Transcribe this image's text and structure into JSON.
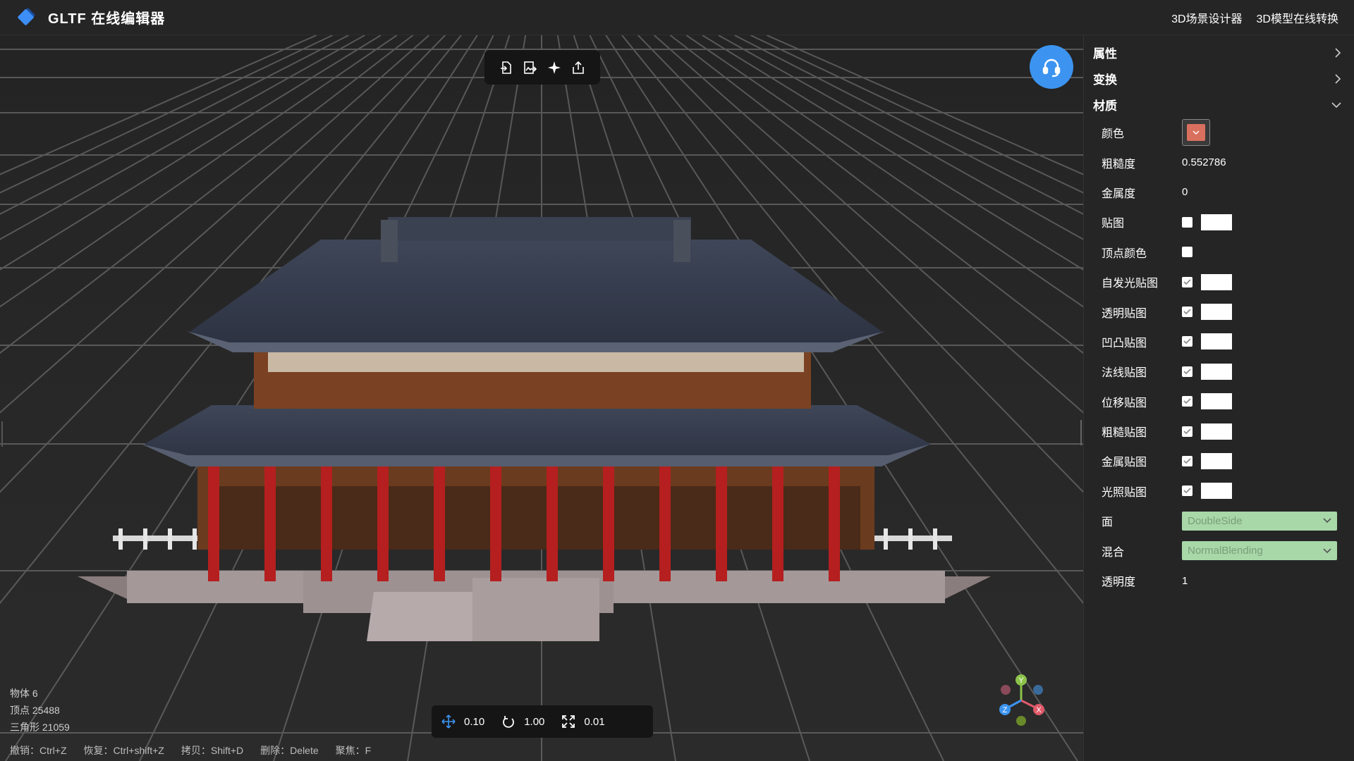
{
  "header": {
    "title": "GLTF 在线编辑器",
    "links": [
      "3D场景设计器",
      "3D模型在线转换"
    ]
  },
  "toolbar": {
    "icons": [
      "import-file-icon",
      "image-import-icon",
      "light-icon",
      "export-icon"
    ]
  },
  "stats": {
    "objects": "物体 6",
    "vertices": "顶点 25488",
    "triangles": "三角形 21059"
  },
  "transform": {
    "move_step": "0.10",
    "rotate_step": "1.00",
    "scale_step": "0.01"
  },
  "shortcuts": [
    "撤销：Ctrl+Z",
    "恢复：Ctrl+shift+Z",
    "拷贝：Shift+D",
    "删除：Delete",
    "聚焦：F"
  ],
  "panel": {
    "sections": {
      "properties": "属性",
      "transform": "变换",
      "material": "材质"
    },
    "material": {
      "color_label": "颜色",
      "color_value": "#d9705f",
      "roughness_label": "粗糙度",
      "roughness_value": "0.552786",
      "metalness_label": "金属度",
      "metalness_value": "0",
      "map_label": "贴图",
      "vertex_color_label": "顶点颜色",
      "emissive_map_label": "自发光贴图",
      "alpha_map_label": "透明贴图",
      "bump_map_label": "凹凸贴图",
      "normal_map_label": "法线贴图",
      "displacement_map_label": "位移贴图",
      "roughness_map_label": "粗糙贴图",
      "metalness_map_label": "金属贴图",
      "light_map_label": "光照贴图",
      "side_label": "面",
      "side_value": "DoubleSide",
      "blending_label": "混合",
      "blending_value": "NormalBlending",
      "opacity_label": "透明度",
      "opacity_value": "1"
    }
  },
  "axis": {
    "y": "Y",
    "x": "X",
    "z": "Z"
  },
  "colors": {
    "accent": "#3c94f0",
    "panel": "#252526",
    "viewport": "#262626"
  }
}
